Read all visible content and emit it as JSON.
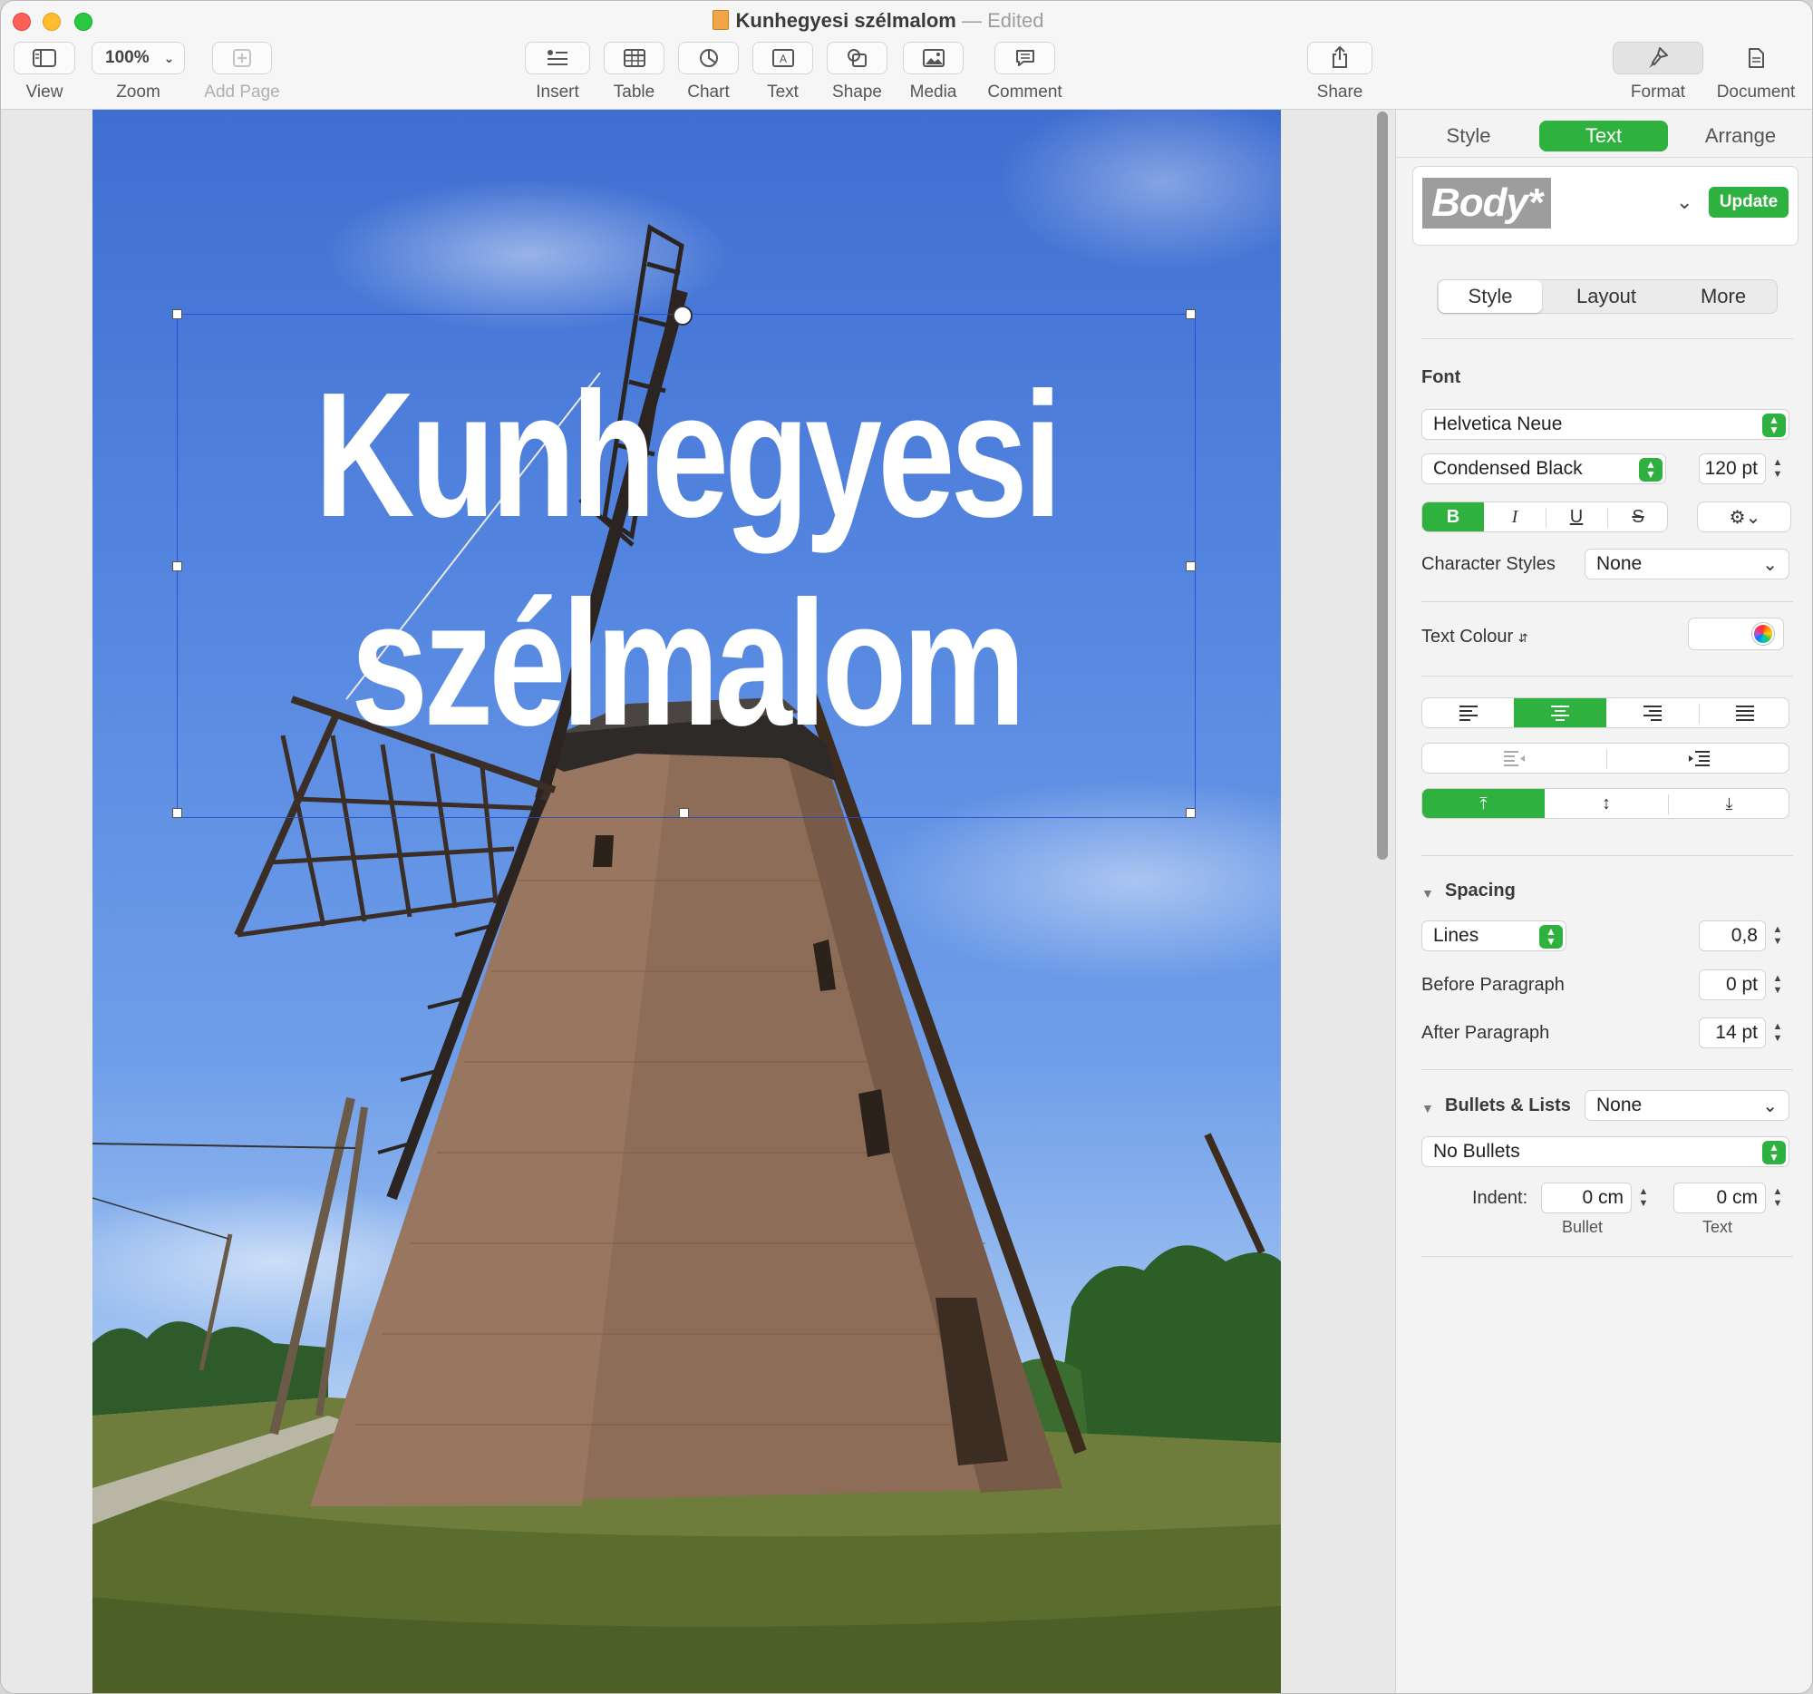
{
  "window": {
    "title": "Kunhegyesi szélmalom",
    "separator": "—",
    "status": "Edited"
  },
  "toolbar": {
    "view": "View",
    "zoom_value": "100%",
    "zoom": "Zoom",
    "add_page": "Add Page",
    "insert": "Insert",
    "table": "Table",
    "chart": "Chart",
    "text": "Text",
    "shape": "Shape",
    "media": "Media",
    "comment": "Comment",
    "share": "Share",
    "format": "Format",
    "document": "Document"
  },
  "document": {
    "headline_line1": "Kunhegyesi",
    "headline_line2": "szélmalom"
  },
  "inspector": {
    "tabs": [
      "Style",
      "Text",
      "Arrange"
    ],
    "active_tab": "Text",
    "paragraph_style": "Body*",
    "update_label": "Update",
    "subtabs": [
      "Style",
      "Layout",
      "More"
    ],
    "font": {
      "heading": "Font",
      "family": "Helvetica Neue",
      "typeface": "Condensed Black",
      "size": "120 pt",
      "bold": "B",
      "italic": "I",
      "underline": "U",
      "strike": "S"
    },
    "character_styles_label": "Character Styles",
    "character_styles_value": "None",
    "text_colour_label": "Text Colour",
    "spacing": {
      "heading": "Spacing",
      "mode": "Lines",
      "lines_value": "0,8",
      "before_label": "Before Paragraph",
      "before_value": "0 pt",
      "after_label": "After Paragraph",
      "after_value": "14 pt"
    },
    "bullets": {
      "heading": "Bullets & Lists",
      "list_style": "None",
      "bullet_type": "No Bullets",
      "indent_label": "Indent:",
      "bullet_indent": "0 cm",
      "text_indent": "0 cm",
      "bullet_caption": "Bullet",
      "text_caption": "Text"
    }
  },
  "colors": {
    "accent": "#2eb13f",
    "selection": "#2846d2"
  }
}
